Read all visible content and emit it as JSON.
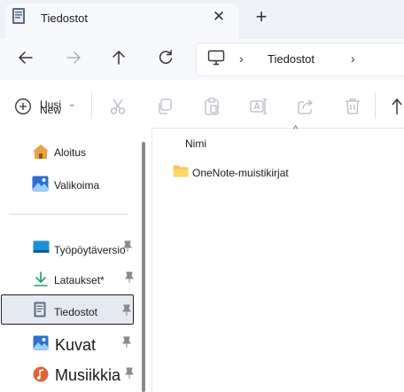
{
  "tab": {
    "title": "Tiedostot",
    "close_glyph": "✕",
    "new_tab_glyph": "+"
  },
  "address": {
    "location": "Tiedostot",
    "chevron": "›"
  },
  "toolbar": {
    "new_label_fi": "Uusi",
    "new_label_en": "New",
    "new_chevron": "⌄"
  },
  "sidebar": {
    "items": [
      {
        "label": "Aloitus",
        "icon": "home-icon"
      },
      {
        "label": "Valikoima",
        "icon": "gallery-icon"
      },
      {
        "label": "Työpöytäversio",
        "icon": "desktop-icon",
        "pinned": true
      },
      {
        "label": "Lataukset*",
        "icon": "download-icon",
        "pinned": true
      },
      {
        "label": "Tiedostot",
        "icon": "documents-icon",
        "pinned": true,
        "selected": true
      },
      {
        "label": "Kuvat",
        "icon": "pictures-icon",
        "pinned": true
      },
      {
        "label": "Musiikkia",
        "icon": "music-icon",
        "pinned": true
      }
    ]
  },
  "content": {
    "column_header": "Nimi",
    "sort_glyph": "^",
    "files": [
      {
        "name": "OneNote-muistikirjat",
        "type": "folder"
      }
    ]
  },
  "colors": {
    "accent": "#0067c0",
    "folder": "#f4c64f",
    "selection": "#e5eaf2"
  }
}
